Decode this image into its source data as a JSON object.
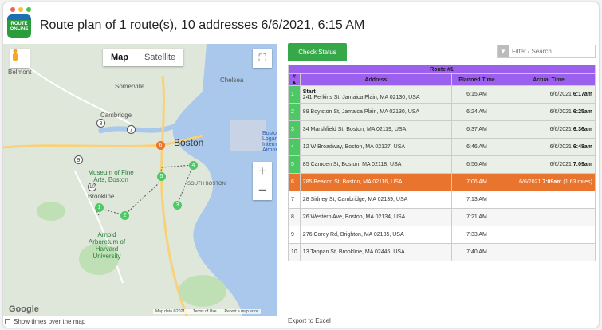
{
  "app": {
    "title": "Route plan of 1 route(s), 10 addresses 6/6/2021, 6:15 AM",
    "logo_text": "ROUTE ONLINE",
    "colors": {
      "done": "#4dc864",
      "current": "#e8742d",
      "header": "#9c60ee",
      "button": "#36a84a"
    }
  },
  "map": {
    "tabs": [
      {
        "label": "Map",
        "active": true
      },
      {
        "label": "Satellite",
        "active": false
      }
    ],
    "zoom_in": "+",
    "zoom_out": "−",
    "fullscreen_icon": "⛶",
    "labels": {
      "belmont": "Belmont",
      "somerville": "Somerville",
      "cambridge": "Cambridge",
      "chelsea": "Chelsea",
      "boston": "Boston",
      "logan": "Boston Logan International Airport",
      "museum": "Museum of Fine Arts, Boston",
      "south_boston": "SOUTH BOSTON",
      "brookline": "Brookline",
      "arnold": "Arnold Arboretum of Harvard University"
    },
    "google": "Google",
    "attribution": [
      "Map data ©2021",
      "Terms of Use",
      "Report a map error"
    ]
  },
  "show_times_label": "Show times over the map",
  "check_status_label": "Check Status",
  "filter_placeholder": "Filter / Search...",
  "table": {
    "route_label": "Route #1",
    "columns": {
      "num": "#",
      "address": "Address",
      "planned": "Planned Time",
      "actual": "Actual Time"
    },
    "sort_icon": "▲",
    "rows": [
      {
        "num": "1",
        "title": "Start",
        "address": "241 Perkins St, Jamaica Plain, MA 02130, USA",
        "planned": "6:15 AM",
        "actual_date": "6/6/2021",
        "actual_time": "6:17am",
        "actual_extra": "",
        "status": "done"
      },
      {
        "num": "2",
        "title": "",
        "address": "89 Boylston St, Jamaica Plain, MA 02130, USA",
        "planned": "6:24 AM",
        "actual_date": "6/6/2021",
        "actual_time": "6:25am",
        "actual_extra": "",
        "status": "done"
      },
      {
        "num": "3",
        "title": "",
        "address": "34 Marshfield St, Boston, MA 02119, USA",
        "planned": "6:37 AM",
        "actual_date": "6/6/2021",
        "actual_time": "6:36am",
        "actual_extra": "",
        "status": "done"
      },
      {
        "num": "4",
        "title": "",
        "address": "12 W Broadway, Boston, MA 02127, USA",
        "planned": "6:46 AM",
        "actual_date": "6/6/2021",
        "actual_time": "6:48am",
        "actual_extra": "",
        "status": "done"
      },
      {
        "num": "5",
        "title": "",
        "address": "85 Camden St, Boston, MA 02118, USA",
        "planned": "6:56 AM",
        "actual_date": "6/6/2021",
        "actual_time": "7:09am",
        "actual_extra": "",
        "status": "done"
      },
      {
        "num": "6",
        "title": "",
        "address": "285 Beacon St, Boston, MA 02116, USA",
        "planned": "7:06 AM",
        "actual_date": "6/6/2021",
        "actual_time": "7:09am",
        "actual_extra": "(1.63 miles)",
        "status": "current"
      },
      {
        "num": "7",
        "title": "",
        "address": "28 Sidney St, Cambridge, MA 02139, USA",
        "planned": "7:13 AM",
        "actual_date": "",
        "actual_time": "",
        "actual_extra": "",
        "status": "pending"
      },
      {
        "num": "8",
        "title": "",
        "address": "26 Western Ave, Boston, MA 02134, USA",
        "planned": "7:21 AM",
        "actual_date": "",
        "actual_time": "",
        "actual_extra": "",
        "status": "pending"
      },
      {
        "num": "9",
        "title": "",
        "address": "276 Corey Rd, Brighton, MA 02135, USA",
        "planned": "7:33 AM",
        "actual_date": "",
        "actual_time": "",
        "actual_extra": "",
        "status": "pending"
      },
      {
        "num": "10",
        "title": "",
        "address": "13 Tappan St, Brookline, MA 02446, USA",
        "planned": "7:40 AM",
        "actual_date": "",
        "actual_time": "",
        "actual_extra": "",
        "status": "pending"
      }
    ]
  },
  "export_label": "Export to Excel"
}
